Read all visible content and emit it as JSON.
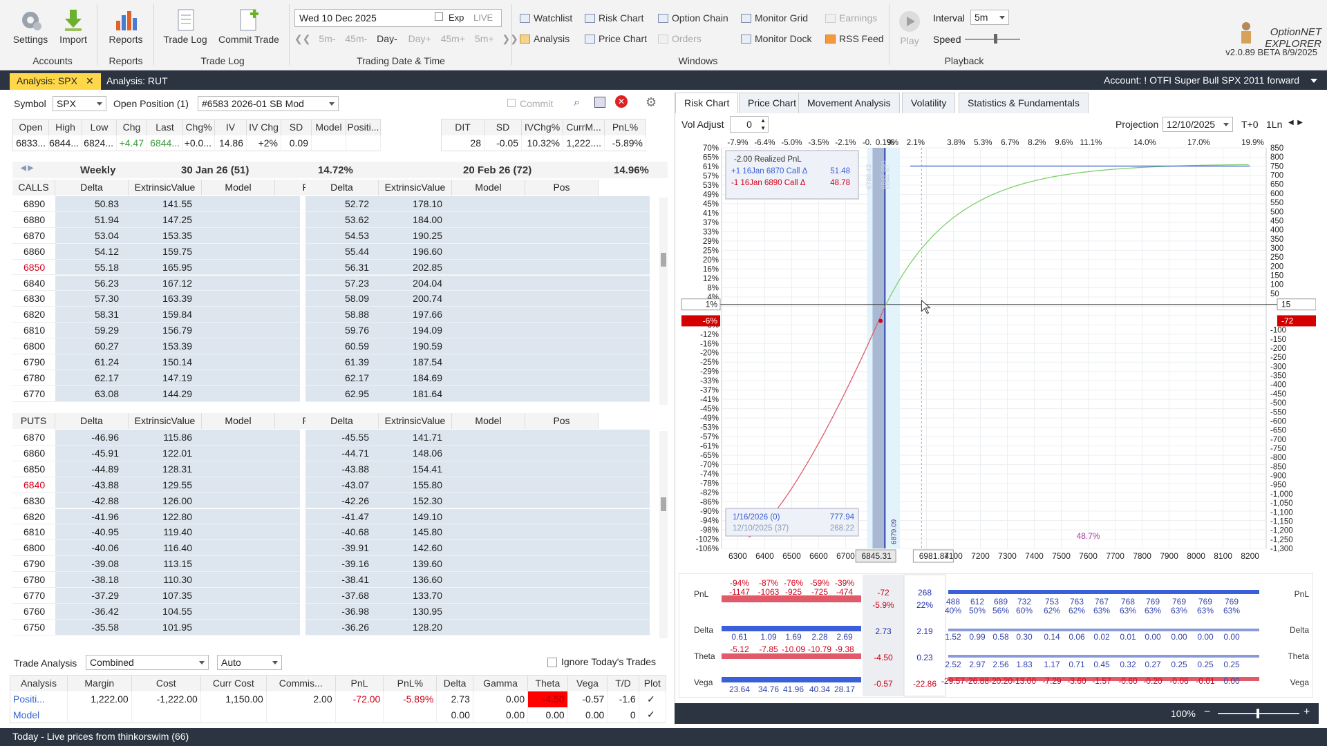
{
  "ribbon": {
    "settings": "Settings",
    "import": "Import",
    "reports": "Reports",
    "trade_log": "Trade Log",
    "commit_trade": "Commit Trade",
    "group_accounts": "Accounts",
    "group_reports": "Reports",
    "group_tradelog": "Trade Log",
    "group_date": "Trading Date & Time",
    "group_windows": "Windows",
    "group_playback": "Playback",
    "date": "Wed 10 Dec 2025",
    "exp": "Exp",
    "live": "LIVE",
    "step_back": [
      "5m-",
      "45m-",
      "Day-"
    ],
    "step_fwd": [
      "Day+",
      "45m+",
      "5m+"
    ],
    "watchlist": "Watchlist",
    "risk_chart": "Risk Chart",
    "option_chain": "Option Chain",
    "monitor_grid": "Monitor Grid",
    "earnings": "Earnings",
    "analysis": "Analysis",
    "price_chart": "Price Chart",
    "orders": "Orders",
    "monitor_dock": "Monitor Dock",
    "rss_feed": "RSS Feed",
    "play": "Play",
    "interval_label": "Interval",
    "interval_value": "5m",
    "speed_label": "Speed",
    "logo": "OptionNET EXPLORER",
    "version": "v2.0.89 BETA 8/9/2025"
  },
  "tabs": {
    "analysis_spx": "Analysis: SPX",
    "analysis_rut": "Analysis: RUT",
    "account": "Account: ! OTFI Super Bull SPX  2011 forward"
  },
  "left": {
    "symbol_label": "Symbol",
    "symbol": "SPX",
    "openpos_label": "Open Position (1)",
    "position": "#6583 2026-01 SB Mod",
    "commit": "Commit",
    "quote_headers": [
      "Open",
      "High",
      "Low",
      "Chg",
      "Last",
      "Chg%",
      "IV",
      "IV Chg",
      "SD",
      "Model",
      "Positi..."
    ],
    "quote_values": [
      "6833...",
      "6844...",
      "6824...",
      "+4.47",
      "6844...",
      "+0.0...",
      "14.86",
      "+2%",
      "0.09",
      "",
      ""
    ],
    "pos_headers": [
      "DIT",
      "SD",
      "IVChg%",
      "CurrM...",
      "PnL%"
    ],
    "pos_values": [
      "28",
      "-0.05",
      "10.32%",
      "1,222....",
      "-5.89%"
    ],
    "exp1": {
      "label": "Weekly",
      "date": "30 Jan 26 (51)",
      "iv": "14.72%"
    },
    "exp2": {
      "date": "20 Feb 26 (72)",
      "iv": "14.96%"
    },
    "calls_label": "CALLS",
    "puts_label": "PUTS",
    "col_headers": [
      "Delta",
      "ExtrinsicValue",
      "Model",
      "Pos"
    ],
    "calls": [
      [
        "6890",
        "50.83",
        "141.55",
        "52.72",
        "178.10"
      ],
      [
        "6880",
        "51.94",
        "147.25",
        "53.62",
        "184.00"
      ],
      [
        "6870",
        "53.04",
        "153.35",
        "54.53",
        "190.25"
      ],
      [
        "6860",
        "54.12",
        "159.75",
        "55.44",
        "196.60"
      ],
      [
        "6850",
        "55.18",
        "165.95",
        "56.31",
        "202.85"
      ],
      [
        "6840",
        "56.23",
        "167.12",
        "57.23",
        "204.04"
      ],
      [
        "6830",
        "57.30",
        "163.39",
        "58.09",
        "200.74"
      ],
      [
        "6820",
        "58.31",
        "159.84",
        "58.88",
        "197.66"
      ],
      [
        "6810",
        "59.29",
        "156.79",
        "59.76",
        "194.09"
      ],
      [
        "6800",
        "60.27",
        "153.39",
        "60.59",
        "190.59"
      ],
      [
        "6790",
        "61.24",
        "150.14",
        "61.39",
        "187.54"
      ],
      [
        "6780",
        "62.17",
        "147.19",
        "62.17",
        "184.69"
      ],
      [
        "6770",
        "63.08",
        "144.29",
        "62.95",
        "181.64"
      ]
    ],
    "puts": [
      [
        "6870",
        "-46.96",
        "115.86",
        "-45.55",
        "141.71"
      ],
      [
        "6860",
        "-45.91",
        "122.01",
        "-44.71",
        "148.06"
      ],
      [
        "6850",
        "-44.89",
        "128.31",
        "-43.88",
        "154.41"
      ],
      [
        "6840",
        "-43.88",
        "129.55",
        "-43.07",
        "155.80"
      ],
      [
        "6830",
        "-42.88",
        "126.00",
        "-42.26",
        "152.30"
      ],
      [
        "6820",
        "-41.96",
        "122.80",
        "-41.47",
        "149.10"
      ],
      [
        "6810",
        "-40.95",
        "119.40",
        "-40.68",
        "145.80"
      ],
      [
        "6800",
        "-40.06",
        "116.40",
        "-39.91",
        "142.60"
      ],
      [
        "6790",
        "-39.08",
        "113.15",
        "-39.16",
        "139.60"
      ],
      [
        "6780",
        "-38.18",
        "110.30",
        "-38.41",
        "136.60"
      ],
      [
        "6770",
        "-37.29",
        "107.35",
        "-37.68",
        "133.70"
      ],
      [
        "6760",
        "-36.42",
        "104.55",
        "-36.98",
        "130.95"
      ],
      [
        "6750",
        "-35.58",
        "101.95",
        "-36.26",
        "128.20"
      ]
    ],
    "trade_analysis_label": "Trade Analysis",
    "ta_mode": "Combined",
    "ta_auto": "Auto",
    "ignore_today": "Ignore Today's Trades",
    "ta_headers": [
      "Analysis",
      "Margin",
      "Cost",
      "Curr Cost",
      "Commis...",
      "PnL",
      "PnL%",
      "Delta",
      "Gamma",
      "Theta",
      "Vega",
      "T/D",
      "Plot"
    ],
    "ta_row1": [
      "Positi...",
      "1,222.00",
      "-1,222.00",
      "1,150.00",
      "2.00",
      "-72.00",
      "-5.89%",
      "2.73",
      "0.00",
      "-4.50",
      "-0.57",
      "-1.6",
      "✓"
    ],
    "ta_row2": [
      "Model",
      "",
      "",
      "",
      "",
      "",
      "",
      "0.00",
      "0.00",
      "0.00",
      "0.00",
      "0",
      "✓"
    ]
  },
  "right": {
    "tabs": [
      "Risk Chart",
      "Price Chart",
      "Movement Analysis",
      "Volatility",
      "Statistics & Fundamentals"
    ],
    "vol_adjust_label": "Vol Adjust",
    "vol_adjust": "0",
    "projection_label": "Projection",
    "projection": "12/10/2025",
    "t0": "T+0",
    "ln": "1Ln",
    "top_pcts": [
      "-7.9%",
      "-6.4%",
      "-5.0%",
      "-3.5%",
      "-2.1%",
      "-0.",
      "0.1%",
      "9%",
      "2.1%",
      "3.8%",
      "5.3%",
      "6.7%",
      "8.2%",
      "9.6%",
      "11.1%",
      "14.0%",
      "17.0%",
      "19.9%"
    ],
    "legend": {
      "realized": "-2.00 Realized PnL",
      "leg1": "+1 16Jan 6870 Call Δ",
      "leg1_val": "51.48",
      "leg2": "-1 16Jan 6890 Call Δ",
      "leg2_val": "48.78"
    },
    "bottom_box": {
      "l1": "1/16/2026 (0)",
      "v1": "777.94",
      "l2": "12/10/2025 (37)",
      "v2": "268.22"
    },
    "pct_note": "48.7%",
    "left_pct_marker": "-6%",
    "right_pnl_marker": "-72",
    "cross_left": "1%",
    "cross_right": "15",
    "vlabels": [
      "6788.43",
      "6842.893",
      "6844.67",
      "6879.09"
    ],
    "x_ticks": [
      "6300",
      "6400",
      "6500",
      "6600",
      "6700",
      "6845.31",
      "6981.84",
      "7100",
      "7200",
      "7300",
      "7400",
      "7500",
      "7600",
      "7700",
      "7800",
      "7900",
      "8000",
      "8100",
      "8200"
    ],
    "y_left": [
      "70%",
      "65%",
      "61%",
      "57%",
      "53%",
      "49%",
      "45%",
      "41%",
      "37%",
      "33%",
      "29%",
      "25%",
      "20%",
      "16%",
      "12%",
      "8%",
      "4%",
      "",
      "",
      "-6%",
      "-12%",
      "-16%",
      "-20%",
      "-25%",
      "-29%",
      "-33%",
      "-37%",
      "-41%",
      "-45%",
      "-49%",
      "-53%",
      "-57%",
      "-61%",
      "-65%",
      "-70%",
      "-74%",
      "-78%",
      "-82%",
      "-86%",
      "-90%",
      "-94%",
      "-98%",
      "-102%",
      "-106%"
    ],
    "y_right": [
      "850",
      "800",
      "750",
      "700",
      "650",
      "600",
      "550",
      "500",
      "450",
      "400",
      "350",
      "300",
      "250",
      "200",
      "150",
      "100",
      "50",
      "",
      "",
      "",
      "-100",
      "-150",
      "-200",
      "-250",
      "-300",
      "-350",
      "-400",
      "-450",
      "-500",
      "-550",
      "-600",
      "-650",
      "-700",
      "-750",
      "-800",
      "-850",
      "-900",
      "-950",
      "-1,000",
      "-1,050",
      "-1,100",
      "-1,150",
      "-1,200",
      "-1,250",
      "-1,300"
    ],
    "greeks": {
      "labels": [
        "PnL",
        "Delta",
        "Theta",
        "Vega"
      ],
      "pnl_pct_left": [
        "-94%",
        "-87%",
        "-76%",
        "-59%",
        "-39%"
      ],
      "pnl_left": [
        "-1147",
        "-1063",
        "-925",
        "-725",
        "-474"
      ],
      "center_pnl": "-72",
      "center_pnlpct": "-5.9%",
      "center2_pnl": "268",
      "center2_pnlpct": "22%",
      "pnl_right": [
        "488",
        "612",
        "689",
        "732",
        "753",
        "763",
        "767",
        "768",
        "769",
        "769",
        "769",
        "769"
      ],
      "pnl_pct_right": [
        "40%",
        "50%",
        "56%",
        "60%",
        "62%",
        "62%",
        "63%",
        "63%",
        "63%",
        "63%",
        "63%",
        "63%"
      ],
      "delta_left": [
        "0.61",
        "1.09",
        "1.69",
        "2.28",
        "2.69"
      ],
      "delta_c1": "2.73",
      "delta_c2": "2.19",
      "delta_right": [
        "1.52",
        "0.99",
        "0.58",
        "0.30",
        "0.14",
        "0.06",
        "0.02",
        "0.01",
        "0.00",
        "0.00",
        "0.00",
        "0.00"
      ],
      "theta_left": [
        "-5.12",
        "-7.85",
        "-10.09",
        "-10.79",
        "-9.38"
      ],
      "theta_c1": "-4.50",
      "theta_c2": "0.23",
      "theta_right": [
        "2.52",
        "2.97",
        "2.56",
        "1.83",
        "1.17",
        "0.71",
        "0.45",
        "0.32",
        "0.27",
        "0.25",
        "0.25",
        "0.25"
      ],
      "vega_left": [
        "23.64",
        "34.76",
        "41.96",
        "40.34",
        "28.17"
      ],
      "vega_c1": "-0.57",
      "vega_c2": "-22.86",
      "vega_right": [
        "-29.57",
        "-26.88",
        "-20.20",
        "-13.00",
        "-7.29",
        "-3.60",
        "-1.57",
        "-0.60",
        "-0.20",
        "-0.06",
        "-0.01",
        "0.00"
      ]
    },
    "zoom": "100%"
  },
  "status": "Today - Live prices from thinkorswim (66)",
  "colors": {
    "accent_tab": "#ffd84a",
    "dark_bar": "#2b3440",
    "profit": "#7ccf6a",
    "loss": "#e05a6a",
    "blue_bar": "#3a5fd9"
  }
}
